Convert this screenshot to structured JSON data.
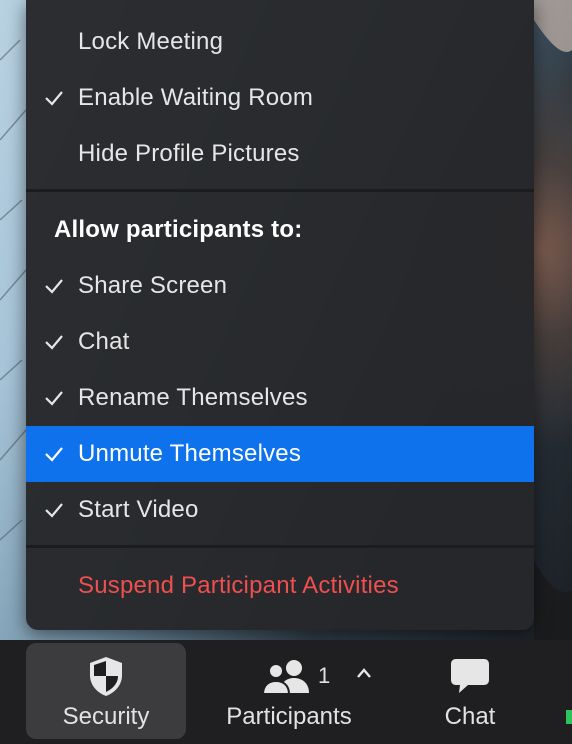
{
  "menu": {
    "top_items": [
      {
        "label": "Lock Meeting",
        "checked": false
      },
      {
        "label": "Enable Waiting Room",
        "checked": true
      },
      {
        "label": "Hide Profile Pictures",
        "checked": false
      }
    ],
    "section_header": "Allow participants to:",
    "allow_items": [
      {
        "label": "Share Screen",
        "checked": true,
        "selected": false
      },
      {
        "label": "Chat",
        "checked": true,
        "selected": false
      },
      {
        "label": "Rename Themselves",
        "checked": true,
        "selected": false
      },
      {
        "label": "Unmute Themselves",
        "checked": true,
        "selected": true
      },
      {
        "label": "Start Video",
        "checked": true,
        "selected": false
      }
    ],
    "danger_item": "Suspend Participant Activities"
  },
  "toolbar": {
    "security_label": "Security",
    "participants_label": "Participants",
    "participants_count": "1",
    "chat_label": "Chat"
  },
  "colors": {
    "menu_bg": "#26272a",
    "selected": "#0e72ed",
    "danger": "#ee4f4f",
    "toolbar_bg": "#1f1f21",
    "toolbar_active": "#3c3c3e"
  }
}
